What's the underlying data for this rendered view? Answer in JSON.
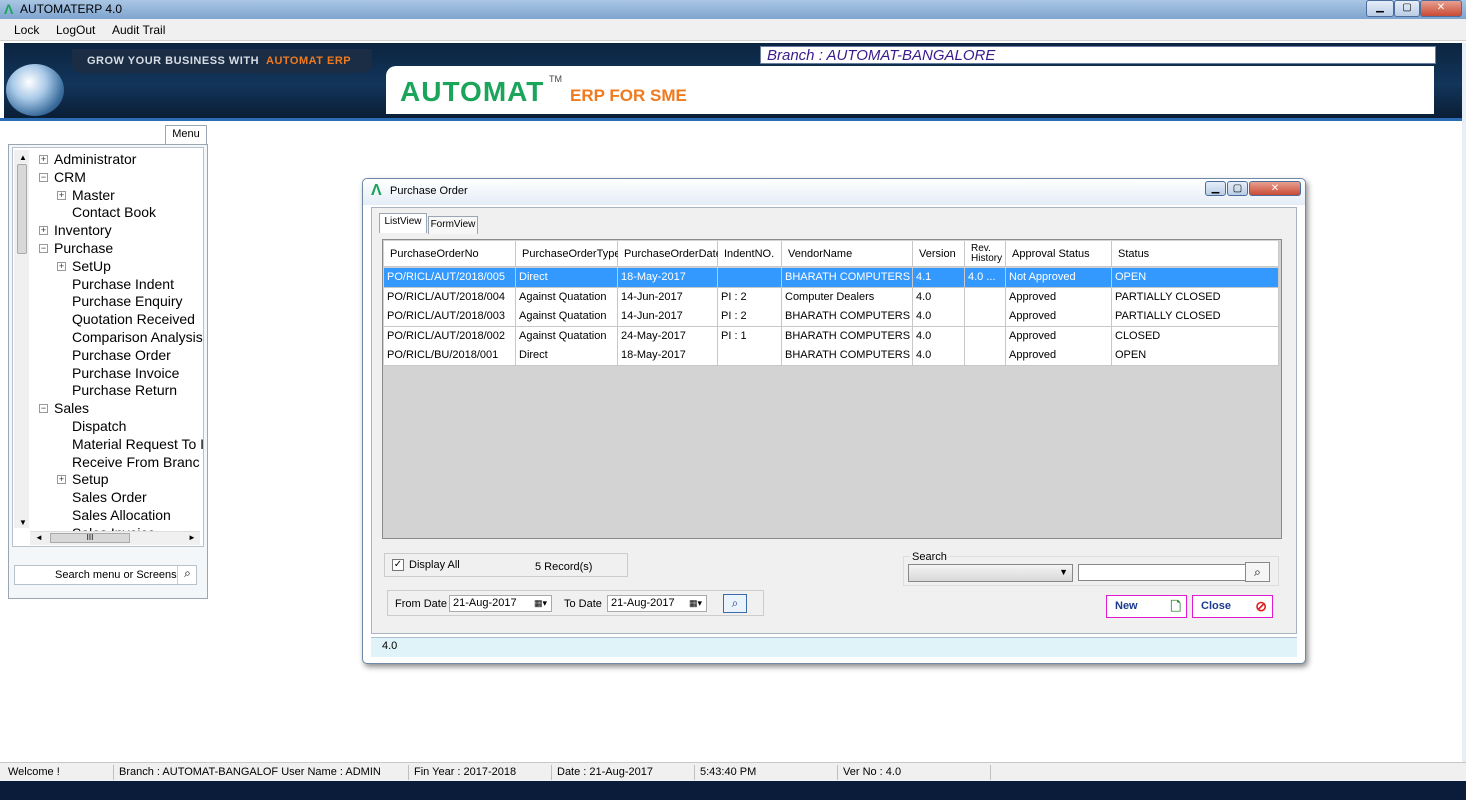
{
  "window": {
    "title": "AUTOMATERP 4.0",
    "min_glyph": "▁",
    "max_glyph": "▢",
    "close_glyph": "✕"
  },
  "menubar": [
    "Lock",
    "LogOut",
    "Audit Trail"
  ],
  "banner": {
    "tagline_prefix": "GROW YOUR BUSINESS WITH",
    "tagline_brand": "AUTOMAT ERP",
    "branch": "Branch : AUTOMAT-BANGALORE",
    "logo": "AUTOMAT",
    "tm": "TM",
    "product": "ERP FOR SME"
  },
  "sidebar": {
    "tab": "Menu",
    "search_placeholder": "Search menu or Screens",
    "scroll_thumb": "III",
    "tree": [
      {
        "label": "Administrator",
        "expander": "+"
      },
      {
        "label": "CRM",
        "expander": "−"
      },
      {
        "label": "Master",
        "expander": "+"
      },
      {
        "label": "Contact Book"
      },
      {
        "label": "Inventory",
        "expander": "+"
      },
      {
        "label": "Purchase",
        "expander": "−"
      },
      {
        "label": "SetUp",
        "expander": "+"
      },
      {
        "label": "Purchase Indent"
      },
      {
        "label": "Purchase Enquiry"
      },
      {
        "label": "Quotation Received"
      },
      {
        "label": "Comparison Analysis"
      },
      {
        "label": "Purchase Order"
      },
      {
        "label": "Purchase Invoice"
      },
      {
        "label": "Purchase Return"
      },
      {
        "label": "Sales",
        "expander": "−"
      },
      {
        "label": "Dispatch"
      },
      {
        "label": "Material Request To I"
      },
      {
        "label": "Receive From Branc"
      },
      {
        "label": "Setup",
        "expander": "+"
      },
      {
        "label": "Sales Order"
      },
      {
        "label": "Sales Allocation"
      },
      {
        "label": "Sales Invoice"
      }
    ]
  },
  "dialog": {
    "title": "Purchase Order",
    "tabs": [
      "ListView",
      "FormView"
    ],
    "columns": [
      "PurchaseOrderNo",
      "PurchaseOrderType",
      "PurchaseOrderDate",
      "IndentNO.",
      "VendorName",
      "Version",
      "Rev. History",
      "Approval Status",
      "Status"
    ],
    "rows": [
      [
        "PO/RICL/AUT/2018/005",
        "Direct",
        "18-May-2017",
        "",
        "BHARATH COMPUTERS",
        "4.1",
        "4.0 ...",
        "Not Approved",
        "OPEN"
      ],
      [
        "PO/RICL/AUT/2018/004",
        "Against Quatation",
        "14-Jun-2017",
        "PI : 2",
        "Computer Dealers",
        "4.0",
        "",
        "Approved",
        "PARTIALLY CLOSED"
      ],
      [
        "PO/RICL/AUT/2018/003",
        "Against Quatation",
        "14-Jun-2017",
        "PI : 2",
        "BHARATH COMPUTERS",
        "4.0",
        "",
        "Approved",
        "PARTIALLY CLOSED"
      ],
      [
        "PO/RICL/AUT/2018/002",
        "Against Quatation",
        "24-May-2017",
        "PI : 1",
        "BHARATH COMPUTERS",
        "4.0",
        "",
        "Approved",
        "CLOSED"
      ],
      [
        "PO/RICL/BU/2018/001",
        "Direct",
        "18-May-2017",
        "",
        "BHARATH COMPUTERS",
        "4.0",
        "",
        "Approved",
        "OPEN"
      ]
    ],
    "display_all_label": "Display All",
    "display_all_checked": true,
    "records": "5 Record(s)",
    "from_label": "From Date",
    "from_date": "21-Aug-2017",
    "to_label": "To Date",
    "to_date": "21-Aug-2017",
    "search_label": "Search",
    "search_value": "",
    "new_label": "New",
    "close_label": "Close",
    "footer": "4.0"
  },
  "statusbar": {
    "welcome": "Welcome !",
    "branch_user": "Branch : AUTOMAT-BANGALOF User Name : ADMIN",
    "fin_year": "Fin Year : 2017-2018",
    "date": "Date : 21-Aug-2017",
    "time": "5:43:40 PM",
    "version": "Ver No : 4.0"
  },
  "colors": {
    "brand_green": "#1aa55a",
    "brand_orange": "#f07a1e",
    "selection": "#3399ff",
    "button_border": "#e01ad0",
    "branch_text": "#3a1a8c"
  }
}
